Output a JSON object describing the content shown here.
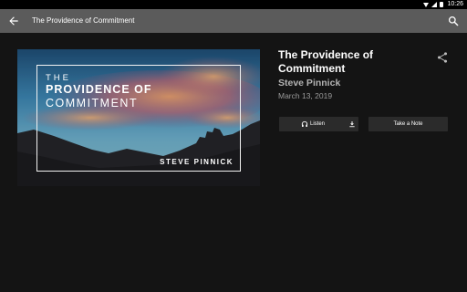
{
  "status_bar": {
    "time": "10:26"
  },
  "app_bar": {
    "title": "The Providence of Commitment"
  },
  "artwork": {
    "line1": "THE",
    "line2": "PROVIDENCE OF",
    "line3": "COMMITMENT",
    "author": "STEVE PINNICK"
  },
  "sermon": {
    "title": "The Providence of Commitment",
    "speaker": "Steve Pinnick",
    "date": "March 13, 2019"
  },
  "actions": {
    "listen_label": "Listen",
    "note_label": "Take a Note"
  },
  "icons": [
    "back-arrow-icon",
    "search-icon",
    "share-icon",
    "headphones-icon",
    "download-icon",
    "wifi-icon",
    "signal-icon",
    "battery-icon"
  ]
}
